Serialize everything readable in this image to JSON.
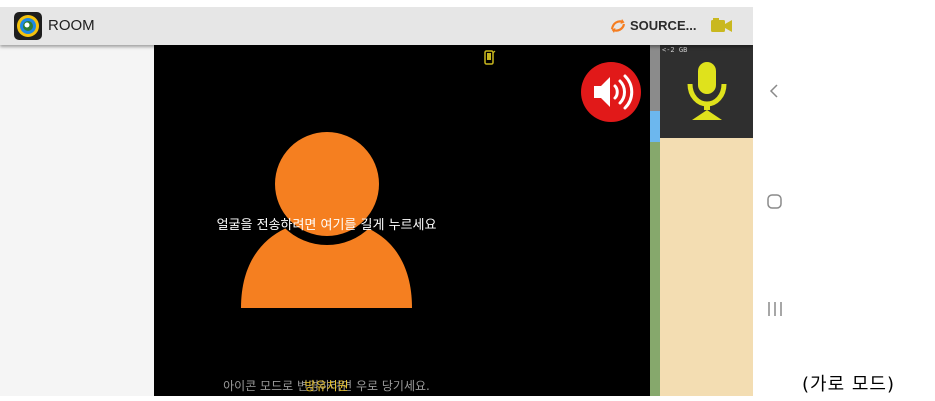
{
  "app": {
    "title": "ROOM",
    "logo_icon": "app-logo-icon"
  },
  "toolbar": {
    "source_label": "SOURCE...",
    "source_icon": "swap-arrows-icon",
    "camera_icon": "video-camera-icon",
    "accent": "#f57d20"
  },
  "video": {
    "hint": "얼굴을 전송하려면 여기를 길게 누르세요",
    "footer_hint": "아이콘 모드로 변경하려면 우로 당기세요.",
    "footer_overlay": "방유치원",
    "avatar_color": "#f57f20",
    "phone_icon": "phone-icon"
  },
  "side_panel": {
    "memory_label": "<-2 GB",
    "mic_icon": "microphone-icon",
    "mic_color": "#dfe21c",
    "speaker_icon": "speaker-icon",
    "speaker_color": "#e11919"
  },
  "nav": {
    "back_icon": "back-icon",
    "home_icon": "home-icon",
    "recents_icon": "recents-icon"
  },
  "caption": "(가로 모드)"
}
